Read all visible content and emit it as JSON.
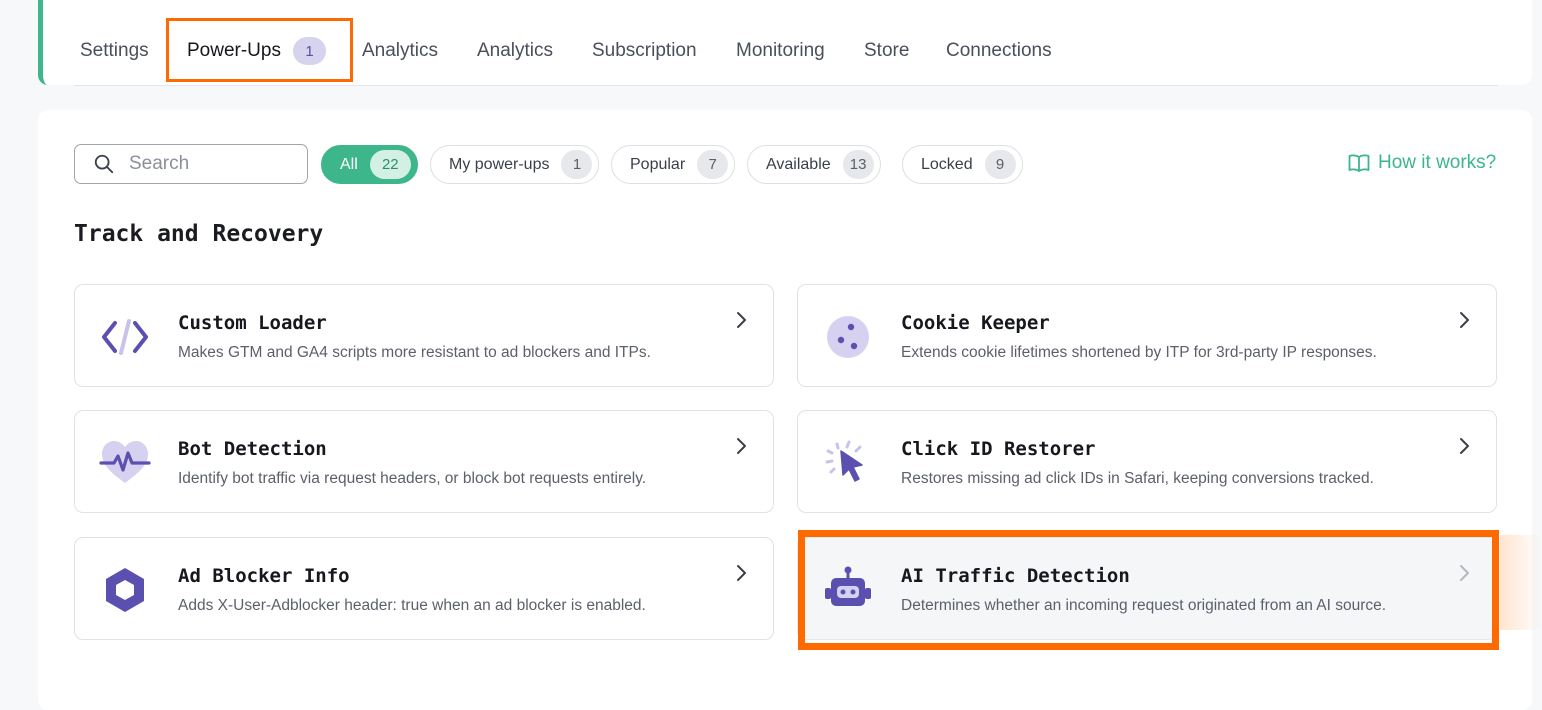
{
  "tabs": [
    {
      "label": "Settings"
    },
    {
      "label": "Power-Ups",
      "badge": "1",
      "active": true
    },
    {
      "label": "Analytics"
    },
    {
      "label": "Analytics"
    },
    {
      "label": "Subscription"
    },
    {
      "label": "Monitoring"
    },
    {
      "label": "Store"
    },
    {
      "label": "Connections"
    }
  ],
  "search": {
    "placeholder": "Search",
    "value": ""
  },
  "filters": [
    {
      "label": "All",
      "count": "22",
      "active": true
    },
    {
      "label": "My power-ups",
      "count": "1"
    },
    {
      "label": "Popular",
      "count": "7"
    },
    {
      "label": "Available",
      "count": "13"
    },
    {
      "label": "Locked",
      "count": "9"
    }
  ],
  "how_it_works": "How it works?",
  "section": {
    "title": "Track and Recovery"
  },
  "cards": [
    {
      "title": "Custom Loader",
      "description": "Makes GTM and GA4 scripts more resistant to ad blockers and ITPs.",
      "icon": "code-icon"
    },
    {
      "title": "Cookie Keeper",
      "description": "Extends cookie lifetimes shortened by ITP for 3rd-party IP responses.",
      "icon": "cookie-icon"
    },
    {
      "title": "Bot Detection",
      "description": "Identify bot traffic via request headers, or block bot requests entirely.",
      "icon": "heartbeat-icon"
    },
    {
      "title": "Click ID Restorer",
      "description": "Restores missing ad click IDs in Safari, keeping conversions tracked.",
      "icon": "cursor-click-icon"
    },
    {
      "title": "Ad Blocker Info",
      "description": "Adds X-User-Adblocker header: true when an ad blocker is enabled.",
      "icon": "hexagon-icon"
    },
    {
      "title": "AI Traffic Detection",
      "description": "Determines whether an incoming request originated from an AI source.",
      "icon": "robot-icon"
    }
  ],
  "colors": {
    "accent": "#3cb68a",
    "icon_purple": "#5b4fb0",
    "icon_light": "#d6d1f0",
    "highlight": "#ff6a00"
  }
}
